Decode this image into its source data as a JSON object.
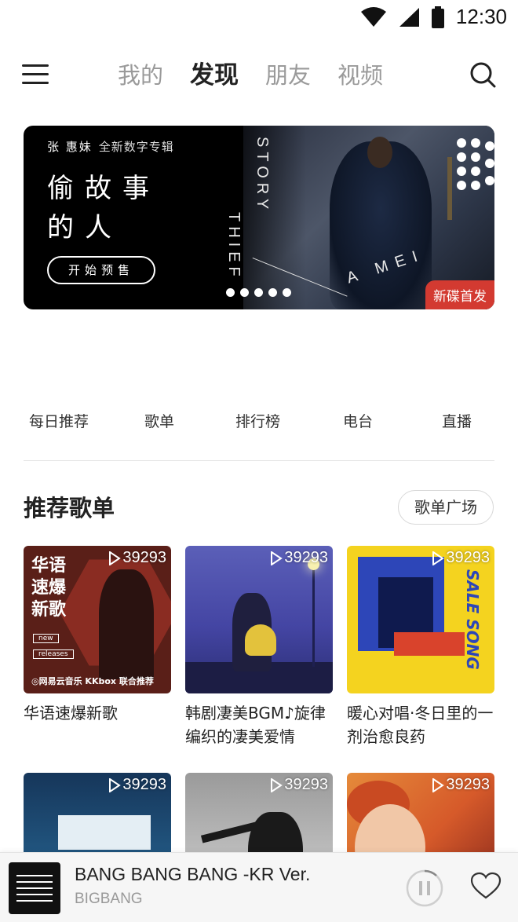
{
  "status_bar": {
    "time": "12:30"
  },
  "nav": {
    "tabs": [
      {
        "label": "我的"
      },
      {
        "label": "发现"
      },
      {
        "label": "朋友"
      },
      {
        "label": "视频"
      }
    ],
    "active_index": 1
  },
  "banner": {
    "artist": "张 惠妹",
    "subtitle": "全新数字专辑",
    "title_line1": "偷故事",
    "title_line2": "的人",
    "button_label": "开始预售",
    "vertical_text_1": "STORY",
    "vertical_text_2": "THIEF",
    "signature": "A MEI",
    "badge": "新碟首发",
    "pages": 5
  },
  "categories": [
    {
      "label": "每日推荐"
    },
    {
      "label": "歌单"
    },
    {
      "label": "排行榜"
    },
    {
      "label": "电台"
    },
    {
      "label": "直播"
    }
  ],
  "section": {
    "title": "推荐歌单",
    "more_button": "歌单广场"
  },
  "playlists": [
    {
      "play_count": "39293",
      "title": "华语速爆新歌",
      "cover_text": "华语速爆新歌",
      "cover_tags": [
        "new",
        "releases"
      ],
      "cover_footer": "◎网易云音乐 KKbox 联合推荐"
    },
    {
      "play_count": "39293",
      "title": "韩剧凄美BGM♪旋律编织的凄美爱情"
    },
    {
      "play_count": "39293",
      "title": "暖心对唱·冬日里的一剂治愈良药",
      "cover_text": "SALE SONG"
    },
    {
      "play_count": "39293",
      "title": ""
    },
    {
      "play_count": "39293",
      "title": ""
    },
    {
      "play_count": "39293",
      "title": ""
    }
  ],
  "player": {
    "track_title": "BANG BANG BANG -KR Ver.",
    "artist": "BIGBANG"
  },
  "colors": {
    "accent_red": "#d33a31",
    "text_primary": "#222222",
    "text_secondary": "#999999"
  },
  "icons": [
    "wifi-icon",
    "signal-icon",
    "battery-icon",
    "menu-icon",
    "search-icon",
    "play-icon",
    "pause-icon",
    "heart-icon"
  ]
}
